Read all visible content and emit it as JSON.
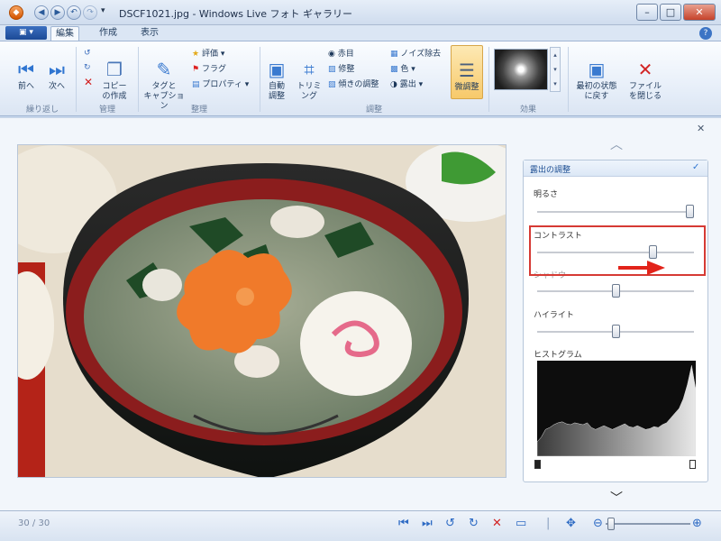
{
  "window": {
    "title": "DSCF1021.jpg - Windows Live フォト ギャラリー"
  },
  "tabs": [
    "編集",
    "作成",
    "表示"
  ],
  "ribbon": {
    "prev": "前へ",
    "next": "次へ",
    "copy": "コピー\nの作成",
    "tags": "タグと\nキャプション",
    "rating": "評価",
    "flag": "フラグ",
    "property": "プロパティ",
    "auto": "自動\n調整",
    "crop": "トリミ\nング",
    "redeye": "赤目",
    "retouch": "修整",
    "straighten": "傾きの調整",
    "noise": "ノイズ除去",
    "color": "色",
    "exposure": "露出",
    "fine": "微調整",
    "revert": "最初の状態\nに戻す",
    "close": "ファイル\nを閉じる",
    "groups": {
      "organize": "繰り返し",
      "manage": "管理",
      "arrange": "整理",
      "adjust": "調整",
      "effects": "効果"
    }
  },
  "panel": {
    "header": "露出の調整",
    "brightness": {
      "label": "明るさ",
      "value": 1.0
    },
    "contrast": {
      "label": "コントラスト",
      "value": 0.75
    },
    "shadow": {
      "label": "シャドウ",
      "value": 0.5
    },
    "highlight": {
      "label": "ハイライト",
      "value": 0.5
    },
    "histogram": {
      "label": "ヒストグラム",
      "values": [
        0.15,
        0.2,
        0.28,
        0.3,
        0.33,
        0.35,
        0.36,
        0.34,
        0.33,
        0.35,
        0.34,
        0.33,
        0.35,
        0.3,
        0.28,
        0.3,
        0.32,
        0.3,
        0.28,
        0.3,
        0.32,
        0.34,
        0.31,
        0.3,
        0.32,
        0.3,
        0.28,
        0.29,
        0.31,
        0.3,
        0.33,
        0.35,
        0.4,
        0.45,
        0.5,
        0.6,
        0.75,
        0.95,
        0.7
      ]
    }
  },
  "status": {
    "counter": "30 / 30"
  }
}
